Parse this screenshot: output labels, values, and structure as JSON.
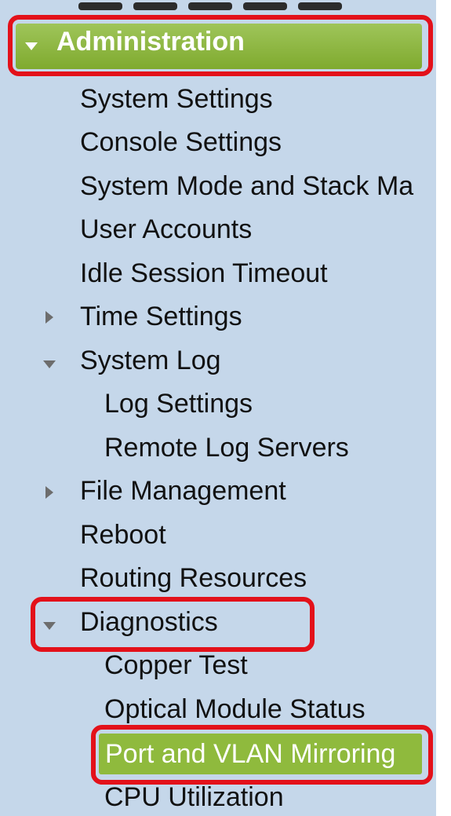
{
  "nav": {
    "section_title": "Administration",
    "items": [
      {
        "label": "System Settings"
      },
      {
        "label": "Console Settings"
      },
      {
        "label": "System Mode and Stack Ma"
      },
      {
        "label": "User Accounts"
      },
      {
        "label": "Idle Session Timeout"
      },
      {
        "label": "Time Settings",
        "expander": "collapsed"
      },
      {
        "label": "System Log",
        "expander": "expanded"
      },
      {
        "label": "Log Settings"
      },
      {
        "label": "Remote Log Servers"
      },
      {
        "label": "File Management",
        "expander": "collapsed"
      },
      {
        "label": "Reboot"
      },
      {
        "label": "Routing Resources"
      },
      {
        "label": "Diagnostics",
        "expander": "expanded"
      },
      {
        "label": "Copper Test"
      },
      {
        "label": "Optical Module Status"
      },
      {
        "label": "Port and VLAN Mirroring",
        "selected": true
      },
      {
        "label": "CPU Utilization"
      }
    ]
  },
  "colors": {
    "sidebar_background": "#c5d7ea",
    "header_green": "#8fba3d",
    "highlight_red": "#e3111a"
  },
  "icons": {
    "collapsed_expander": "triangle-right-icon",
    "expanded_expander": "triangle-down-icon"
  }
}
